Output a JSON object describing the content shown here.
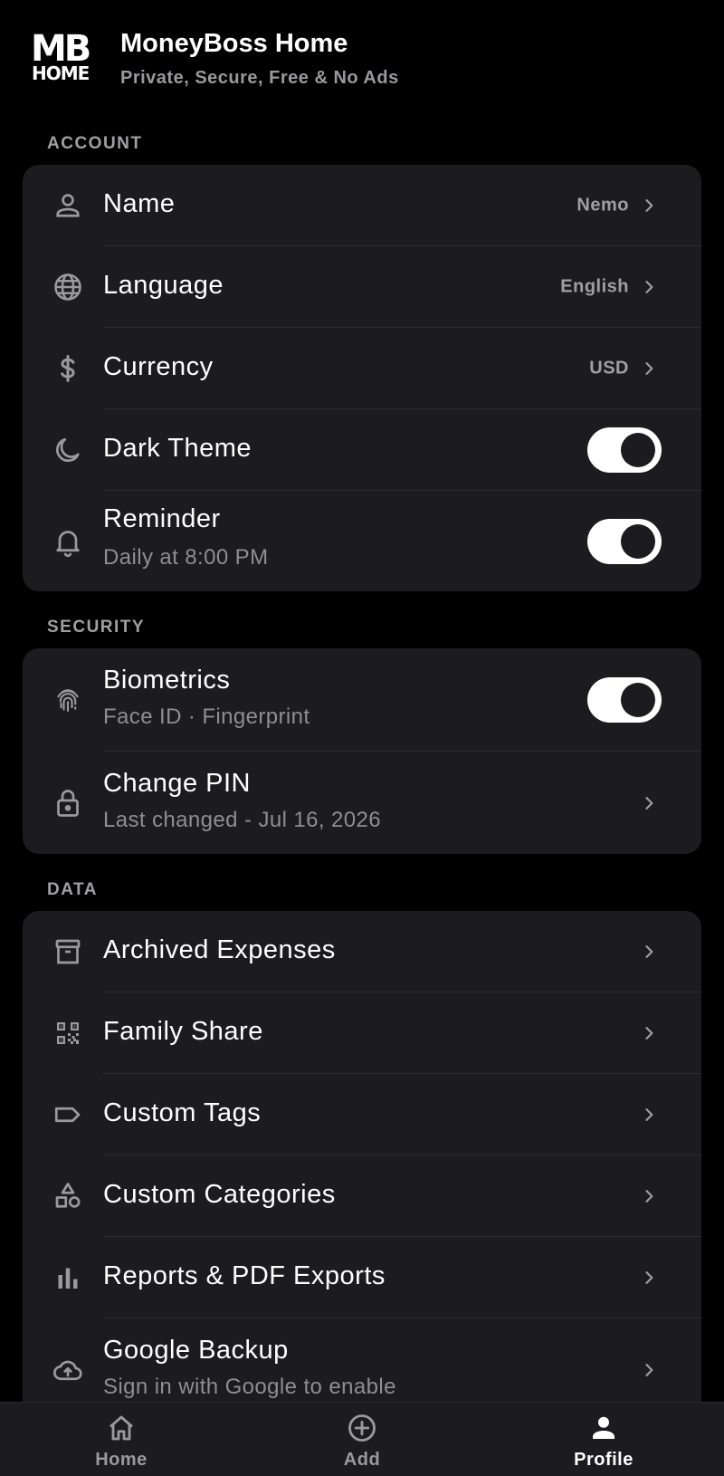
{
  "app": {
    "logo_top": "MB",
    "logo_bottom": "HOME",
    "title": "MoneyBoss Home",
    "subtitle": "Private, Secure, Free & No Ads"
  },
  "sections": {
    "account": {
      "label": "ACCOUNT",
      "items": [
        {
          "icon": "person-icon",
          "label": "Name",
          "value": "Nemo",
          "control": "chevron"
        },
        {
          "icon": "globe-icon",
          "label": "Language",
          "value": "English",
          "control": "chevron"
        },
        {
          "icon": "dollar-icon",
          "label": "Currency",
          "value": "USD",
          "control": "chevron"
        },
        {
          "icon": "moon-icon",
          "label": "Dark Theme",
          "control": "toggle",
          "on": true
        },
        {
          "icon": "bell-icon",
          "label": "Reminder",
          "sublabel": "Daily at 8:00 PM",
          "control": "toggle",
          "on": true
        }
      ]
    },
    "security": {
      "label": "SECURITY",
      "items": [
        {
          "icon": "fingerprint-icon",
          "label": "Biometrics",
          "sublabel": "Face ID · Fingerprint",
          "control": "toggle",
          "on": true
        },
        {
          "icon": "lock-icon",
          "label": "Change PIN",
          "sublabel": "Last changed - Jul 16, 2026",
          "control": "chevron"
        }
      ]
    },
    "data": {
      "label": "DATA",
      "items": [
        {
          "icon": "archive-icon",
          "label": "Archived Expenses",
          "control": "chevron"
        },
        {
          "icon": "qr-code-icon",
          "label": "Family Share",
          "control": "chevron"
        },
        {
          "icon": "tag-icon",
          "label": "Custom Tags",
          "control": "chevron"
        },
        {
          "icon": "shapes-icon",
          "label": "Custom Categories",
          "control": "chevron"
        },
        {
          "icon": "bar-chart-icon",
          "label": "Reports & PDF Exports",
          "control": "chevron"
        },
        {
          "icon": "cloud-upload-icon",
          "label": "Google Backup",
          "sublabel": "Sign in with Google to enable",
          "control": "chevron"
        }
      ]
    }
  },
  "bottom_nav": [
    {
      "icon": "home-icon",
      "label": "Home",
      "active": false
    },
    {
      "icon": "add-circle-icon",
      "label": "Add",
      "active": false
    },
    {
      "icon": "profile-icon",
      "label": "Profile",
      "active": true
    }
  ],
  "colors": {
    "background": "#000000",
    "card": "#1c1c1e",
    "divider": "#2c2c2e",
    "secondary_text": "#8e8e93",
    "toggle_on": "#ffffff"
  }
}
